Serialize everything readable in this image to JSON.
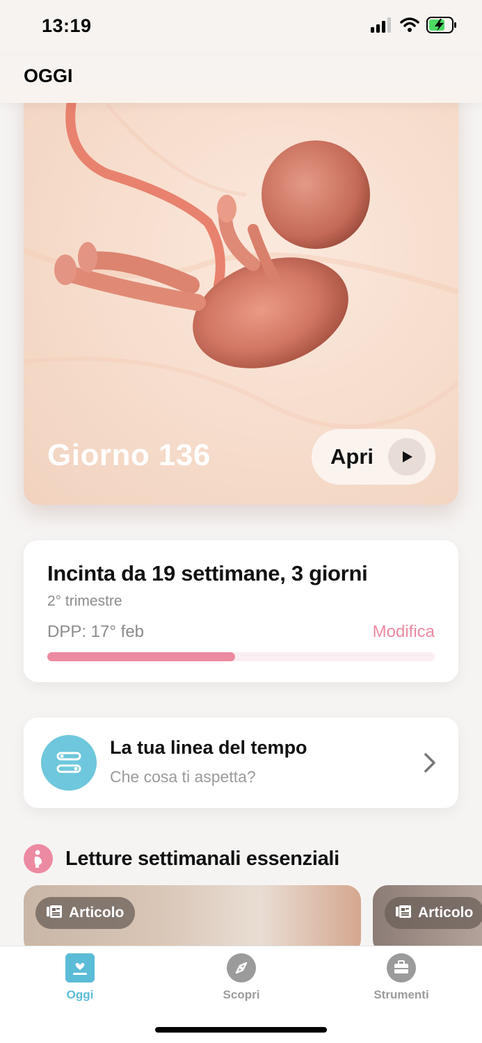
{
  "status": {
    "time": "13:19"
  },
  "header": {
    "title": "OGGI"
  },
  "hero": {
    "day_label": "Giorno 136",
    "open_label": "Apri"
  },
  "pregnancy": {
    "title": "Incinta da 19 settimane, 3 giorni",
    "trimester": "2° trimestre",
    "due_date": "DPP: 17° feb",
    "edit_label": "Modifica",
    "progress": 0.485
  },
  "timeline": {
    "title": "La tua linea del tempo",
    "subtitle": "Che cosa ti aspetta?"
  },
  "section": {
    "title": "Letture settimanali essenziali"
  },
  "articles": [
    {
      "tag": "Articolo"
    },
    {
      "tag": "Articolo"
    }
  ],
  "tabs": [
    {
      "label": "Oggi",
      "icon": "today-icon",
      "active": true
    },
    {
      "label": "Scopri",
      "icon": "compass-icon",
      "active": false
    },
    {
      "label": "Strumenti",
      "icon": "toolbox-icon",
      "active": false
    }
  ],
  "colors": {
    "accent_pink": "#ec8aa1",
    "accent_blue": "#5bbcd8",
    "inactive": "#9b9b9b"
  }
}
